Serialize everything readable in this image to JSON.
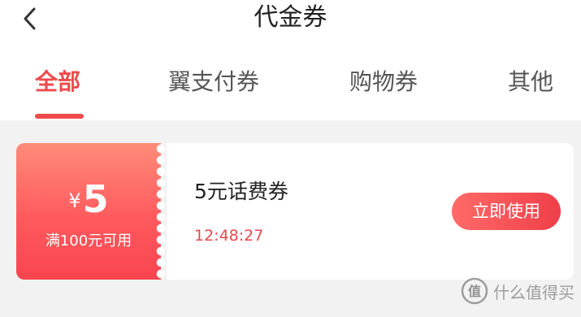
{
  "header": {
    "title": "代金券",
    "back_icon": "chevron-left-icon"
  },
  "tabs": [
    {
      "label": "全部",
      "active": true
    },
    {
      "label": "翼支付券",
      "active": false
    },
    {
      "label": "购物券",
      "active": false
    },
    {
      "label": "其他",
      "active": false
    }
  ],
  "coupons": [
    {
      "currency": "¥",
      "amount": "5",
      "condition": "满100元可用",
      "name": "5元话费券",
      "expiry": "12:48:27",
      "button_label": "立即使用"
    }
  ],
  "watermark": {
    "text": "什么值得买",
    "icon": "smzdm-logo"
  },
  "colors": {
    "accent": "#ee4a4c",
    "stub_gradient_top": "#ff8c79",
    "stub_gradient_bottom": "#f8454f",
    "background": "#f2f2f2"
  }
}
